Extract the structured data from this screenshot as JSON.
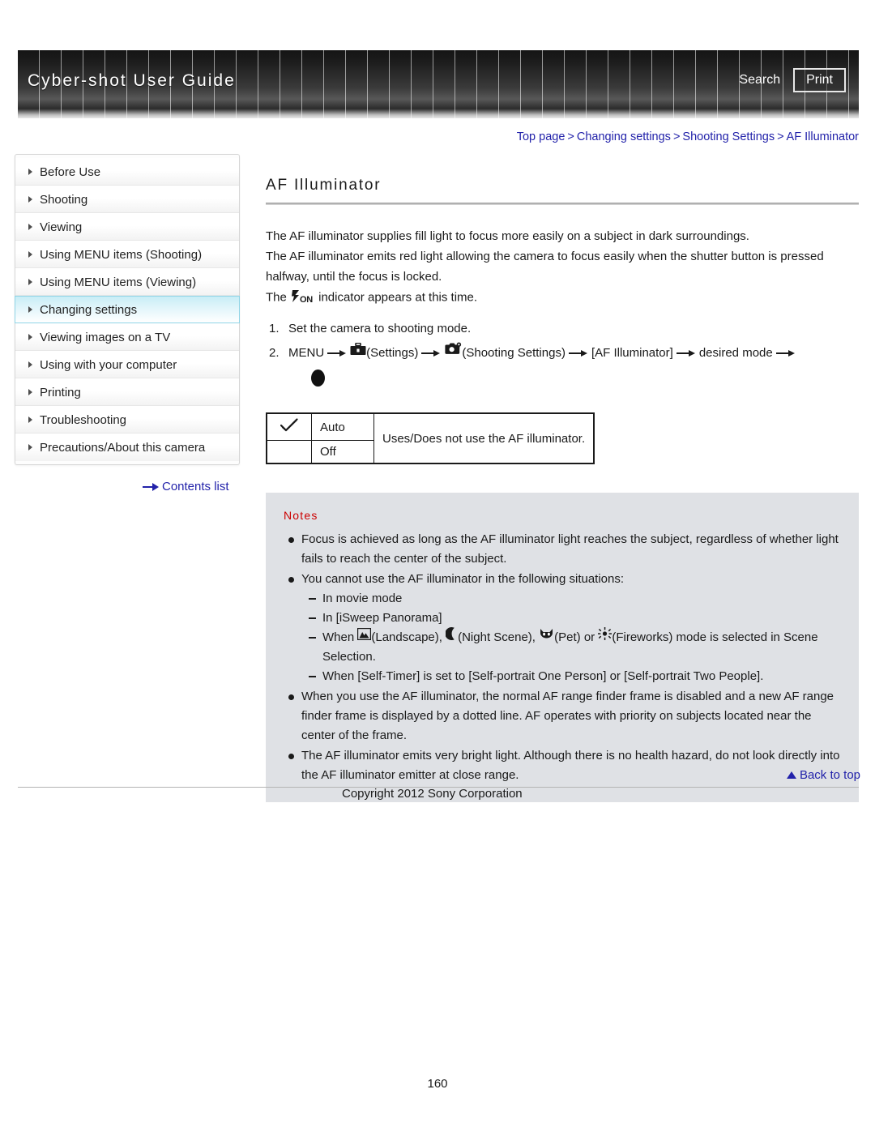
{
  "header": {
    "title": "Cyber-shot User Guide",
    "search_label": "Search",
    "print_label": "Print"
  },
  "breadcrumb": {
    "items": [
      "Top page",
      "Changing settings",
      "Shooting Settings",
      "AF Illuminator"
    ],
    "separator": ">"
  },
  "sidebar": {
    "items": [
      {
        "label": "Before Use",
        "selected": false
      },
      {
        "label": "Shooting",
        "selected": false
      },
      {
        "label": "Viewing",
        "selected": false
      },
      {
        "label": "Using MENU items (Shooting)",
        "selected": false
      },
      {
        "label": "Using MENU items (Viewing)",
        "selected": false
      },
      {
        "label": "Changing settings",
        "selected": true
      },
      {
        "label": "Viewing images on a TV",
        "selected": false
      },
      {
        "label": "Using with your computer",
        "selected": false
      },
      {
        "label": "Printing",
        "selected": false
      },
      {
        "label": "Troubleshooting",
        "selected": false
      },
      {
        "label": "Precautions/About this camera",
        "selected": false
      }
    ],
    "contents_link": "Contents list"
  },
  "main": {
    "title": "AF Illuminator",
    "intro": [
      "The AF illuminator supplies fill light to focus more easily on a subject in dark surroundings.",
      "The AF illuminator emits red light allowing the camera to focus easily when the shutter button is pressed halfway, until the focus is locked."
    ],
    "indicator_line": {
      "prefix": "The",
      "icon_label": "ON",
      "suffix": "indicator appears at this time."
    },
    "steps": [
      {
        "number": "1.",
        "text": "Set the camera to shooting mode."
      },
      {
        "number": "2.",
        "menu_label": "MENU",
        "settings_label": "(Settings)",
        "shooting_settings_label": "(Shooting Settings)",
        "item_label": "[AF Illuminator]",
        "mode_label": "desired mode"
      }
    ],
    "option_table": {
      "rows": [
        {
          "checked": true,
          "name": "Auto"
        },
        {
          "checked": false,
          "name": "Off"
        }
      ],
      "description": "Uses/Does not use the AF illuminator."
    },
    "notes": {
      "title": "Notes",
      "items": [
        {
          "text": "Focus is achieved as long as the AF illuminator light reaches the subject, regardless of whether light fails to reach the center of the subject."
        },
        {
          "text": "You cannot use the AF illuminator in the following situations:",
          "sub_items": [
            {
              "text": "In movie mode"
            },
            {
              "text": "In [iSweep Panorama]"
            },
            {
              "rich": true,
              "part1": "When",
              "landscape_label": "(Landscape),",
              "night_label": "(Night Scene),",
              "pet_label": "(Pet) or",
              "fireworks_label": "(Fireworks) mode is selected in Scene Selection."
            },
            {
              "text": "When [Self-Timer] is set to [Self-portrait One Person] or [Self-portrait Two People]."
            }
          ]
        },
        {
          "text": "When you use the AF illuminator, the normal AF range finder frame is disabled and a new AF range finder frame is displayed by a dotted line. AF operates with priority on subjects located near the center of the frame."
        },
        {
          "text": "The AF illuminator emits very bright light. Although there is no health hazard, do not look directly into the AF illuminator emitter at close range."
        }
      ]
    }
  },
  "footer": {
    "back_to_top": "Back to top",
    "copyright": "Copyright 2012 Sony Corporation",
    "page_number": "160"
  },
  "colors": {
    "link": "#2222aa",
    "notes_title": "#cc0000",
    "notes_bg": "#dfe1e5",
    "sidebar_selected": "#c8edf6"
  }
}
